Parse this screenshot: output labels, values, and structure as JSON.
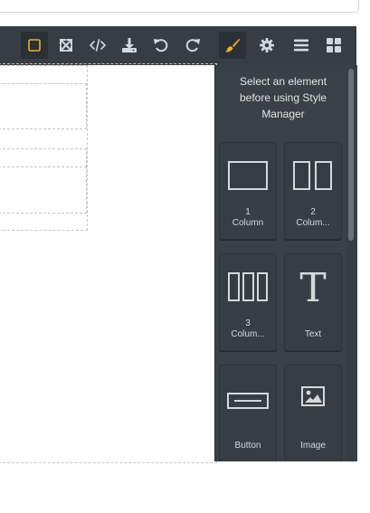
{
  "toolbar": {
    "buttons": [
      {
        "name": "sw-visibility",
        "icon": "square-outline-icon",
        "active": true
      },
      {
        "name": "fullscreen",
        "icon": "expand-arrows-icon",
        "active": false
      },
      {
        "name": "export-code",
        "icon": "code-icon",
        "active": false
      },
      {
        "name": "import",
        "icon": "download-icon",
        "active": false
      },
      {
        "name": "undo",
        "icon": "undo-icon",
        "active": false
      },
      {
        "name": "redo",
        "icon": "redo-icon",
        "active": false
      },
      {
        "name": "style-manager",
        "icon": "paint-brush-icon",
        "active": true
      },
      {
        "name": "settings",
        "icon": "gear-icon",
        "active": false
      },
      {
        "name": "layer-manager",
        "icon": "bars-icon",
        "active": false
      },
      {
        "name": "blocks",
        "icon": "th-large-icon",
        "active": false
      }
    ],
    "accent_color": "#f2b01e",
    "icon_color": "#d5d7da"
  },
  "panel": {
    "message": "Select an element before using Style Manager",
    "blocks": [
      {
        "label": "1\nColumn",
        "icon": "one-column-icon"
      },
      {
        "label": "2\nColum...",
        "icon": "two-column-icon"
      },
      {
        "label": "3\nColum...",
        "icon": "three-column-icon"
      },
      {
        "label": "Text",
        "icon": "text-t-icon"
      },
      {
        "label": "Button",
        "icon": "button-icon"
      },
      {
        "label": "Image",
        "icon": "image-icon"
      }
    ]
  },
  "colors": {
    "panel_bg": "#3a4047",
    "toolbar_bg": "#373d44"
  }
}
